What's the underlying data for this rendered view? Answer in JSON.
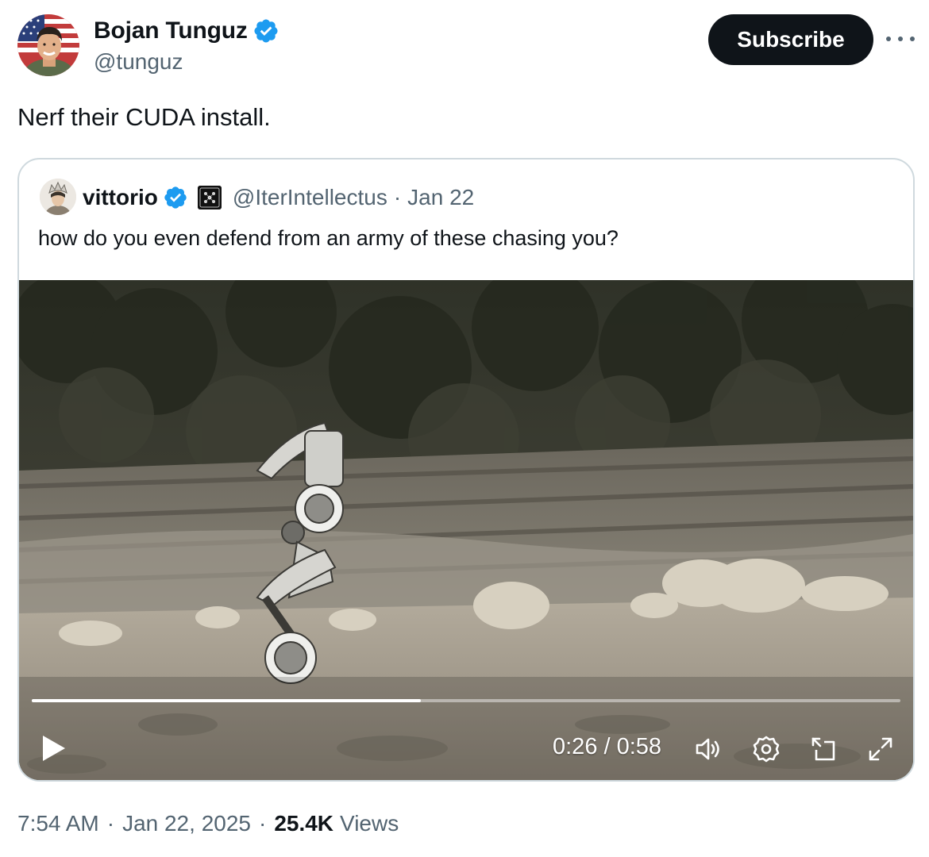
{
  "author": {
    "name": "Bojan Tunguz",
    "handle": "@tunguz",
    "verified": true
  },
  "actions": {
    "subscribe_label": "Subscribe",
    "more_icon": "more-horizontal-icon"
  },
  "tweet": {
    "text": "Nerf their CUDA install."
  },
  "quoted": {
    "name": "vittorio",
    "handle": "@IterIntellectus",
    "separator": "·",
    "date": "Jan 22",
    "text": "how do you even defend from an army of these chasing you?",
    "video": {
      "current_time": "0:26",
      "duration": "0:58",
      "time_display": "0:26 / 0:58",
      "progress": 0.448,
      "icons": [
        "play-icon",
        "volume-icon",
        "settings-icon",
        "picture-in-picture-icon",
        "fullscreen-icon"
      ]
    }
  },
  "meta": {
    "time": "7:54 AM",
    "date": "Jan 22, 2025",
    "separator": "·",
    "views_count": "25.4K",
    "views_label": "Views"
  },
  "colors": {
    "text_primary": "#0f1419",
    "text_secondary": "#536471",
    "verified_blue": "#1d9bf0",
    "border": "#cfd9de",
    "button_bg": "#0f1419"
  }
}
